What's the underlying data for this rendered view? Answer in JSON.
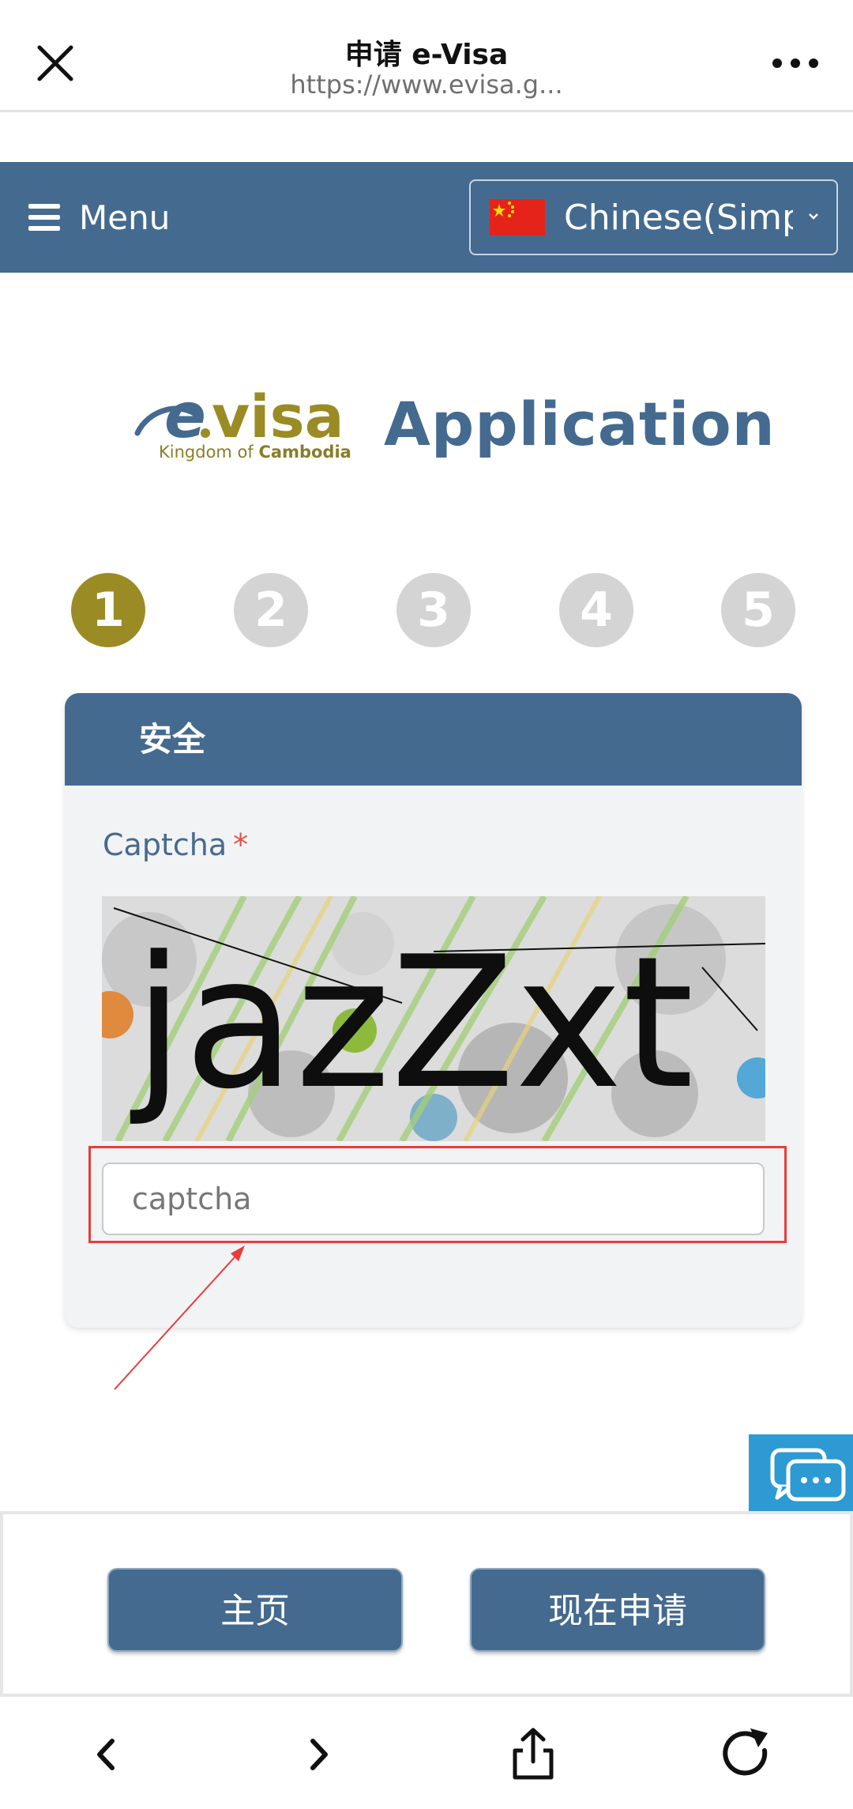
{
  "browser": {
    "title": "申请 e-Visa",
    "url": "https://www.evisa.g..."
  },
  "nav": {
    "menu_label": "Menu",
    "language": "Chinese(Simplified)"
  },
  "logo": {
    "brand": "e.visa",
    "subtitle_prefix": "Kingdom of",
    "subtitle_country": "Cambodia",
    "title": "Application"
  },
  "steps": [
    "1",
    "2",
    "3",
    "4",
    "5"
  ],
  "active_step": 1,
  "card": {
    "header": "安全",
    "captcha_label": "Captcha",
    "required_mark": "*",
    "captcha_text": "jazZxt",
    "input_placeholder": "captcha",
    "input_value": ""
  },
  "actions": {
    "home_label": "主页",
    "apply_label": "现在申请"
  },
  "colors": {
    "primary": "#456a90",
    "step_active": "#9b8b24",
    "step_inactive": "#d4d4d4",
    "highlight": "#ea3b3b",
    "chat": "#2d9ad3"
  }
}
